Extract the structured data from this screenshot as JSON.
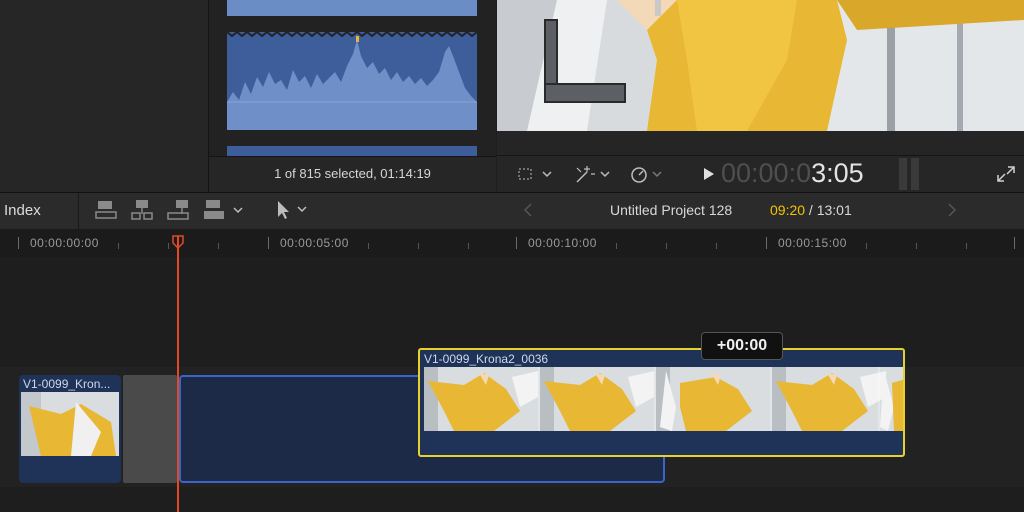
{
  "browser": {
    "status": "1 of 815 selected, 01:14:19"
  },
  "viewer": {
    "timecode_dim": "00:00:0",
    "timecode_hi": "3:05",
    "icons": [
      "crop-icon",
      "magic-wand-icon",
      "speedometer-icon",
      "play-icon",
      "fullscreen-icon"
    ]
  },
  "toolbar": {
    "index_label": "Index",
    "project_name": "Untitled Project 128",
    "current_time": "09:20",
    "separator": " / ",
    "total_time": "13:01"
  },
  "ruler": {
    "labels": [
      "00:00:00:00",
      "00:00:05:00",
      "00:00:10:00",
      "00:00:15:00"
    ]
  },
  "clips": {
    "left_clip_name": "V1-0099_Kron...",
    "dragged_clip_name": "V1-0099_Krona2_0036"
  },
  "drag_offset": "+00:00",
  "colors": {
    "accent_yellow": "#f2c300",
    "playhead": "#e24a26",
    "clip_blue": "#1f3257",
    "selection_outline": "#3a64c8"
  }
}
